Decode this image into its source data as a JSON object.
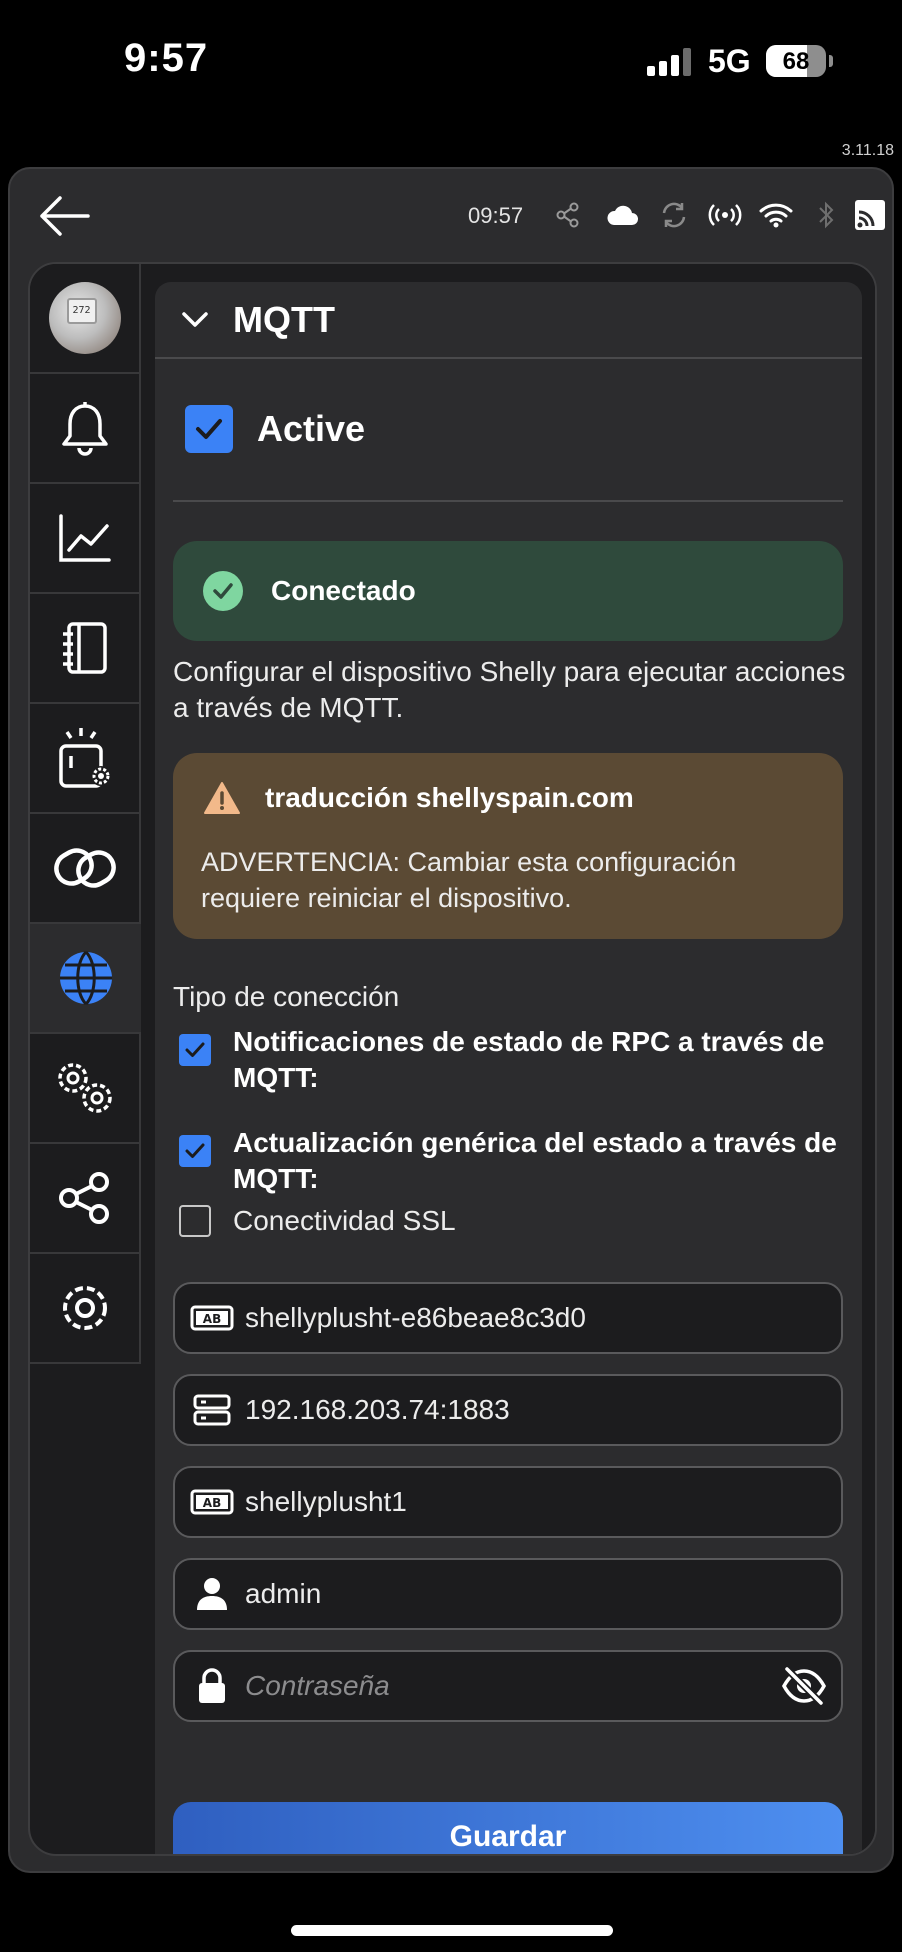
{
  "status_bar": {
    "time": "9:57",
    "network": "5G",
    "battery": "68",
    "battery_level": 0.68,
    "signal_icon": "cellular-signal-icon"
  },
  "app": {
    "version": "3.11.18",
    "topbar": {
      "time": "09:57",
      "icons": [
        "share-icon",
        "cloud-icon",
        "sync-icon",
        "broadcast-icon",
        "wifi-icon",
        "bluetooth-icon",
        "cast-icon"
      ]
    },
    "sidebar": {
      "items": [
        "device-avatar",
        "bell-icon",
        "chart-icon",
        "notebook-icon",
        "device-settings-icon",
        "link-icon",
        "globe-icon",
        "gears-icon",
        "share-nodes-icon",
        "settings-icon"
      ],
      "active": "globe-icon"
    }
  },
  "mqtt": {
    "title": "MQTT",
    "active_label": "Active",
    "active_checked": true,
    "status": "Conectado",
    "description": "Configurar el dispositivo Shelly para ejecutar acciones a través de MQTT.",
    "warning_title": "traducción shellyspain.com",
    "warning_body": "ADVERTENCIA: Cambiar esta configuración requiere reiniciar el dispositivo.",
    "connection_type_label": "Tipo de conección",
    "options": [
      {
        "label": "Notificaciones de estado de RPC a través de MQTT:",
        "checked": true
      },
      {
        "label": "Actualización genérica del estado a través de MQTT:",
        "checked": true
      },
      {
        "label": "Conectividad SSL",
        "checked": false
      }
    ],
    "fields": {
      "client_id": "shellyplusht-e86beae8c3d0",
      "server": "192.168.203.74:1883",
      "topic_prefix": "shellyplusht1",
      "user": "admin",
      "password_placeholder": "Contraseña"
    },
    "save_label": "Guardar"
  },
  "colors": {
    "accent": "#3b82f6",
    "success_bg": "#2f4a3c",
    "warning_bg": "#5b4a34",
    "card_bg": "#2c2c2e"
  }
}
